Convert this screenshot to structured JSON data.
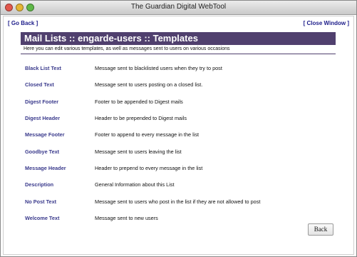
{
  "window": {
    "title": "The Guardian Digital WebTool"
  },
  "nav": {
    "go_back": "[ Go Back ]",
    "close_window": "[ Close Window ]"
  },
  "page": {
    "heading": "Mail Lists :: engarde-users :: Templates",
    "subtitle": "Here you can edit various templates, as well as messages sent to users on various occasions"
  },
  "templates": [
    {
      "label": "Black List Text",
      "description": "Message sent to blacklisted users when they try to post"
    },
    {
      "label": "Closed Text",
      "description": "Message sent to users posting on a closed list."
    },
    {
      "label": "Digest Footer",
      "description": "Footer to be appended to Digest mails"
    },
    {
      "label": "Digest Header",
      "description": "Header to be prepended to Digest mails"
    },
    {
      "label": "Message Footer",
      "description": "Footer to append to every message in the list"
    },
    {
      "label": "Goodbye Text",
      "description": "Message sent to users leaving the list"
    },
    {
      "label": "Message Header",
      "description": "Header to prepend to every message in the list"
    },
    {
      "label": "Description",
      "description": "General Information about this List"
    },
    {
      "label": "No Post Text",
      "description": "Message sent to users who post in the list if they are not allowed to post"
    },
    {
      "label": "Welcome Text",
      "description": "Message sent to new users"
    }
  ],
  "buttons": {
    "back": "Back"
  },
  "colors": {
    "header_bar": "#50406e",
    "link": "#3a3a8c"
  }
}
